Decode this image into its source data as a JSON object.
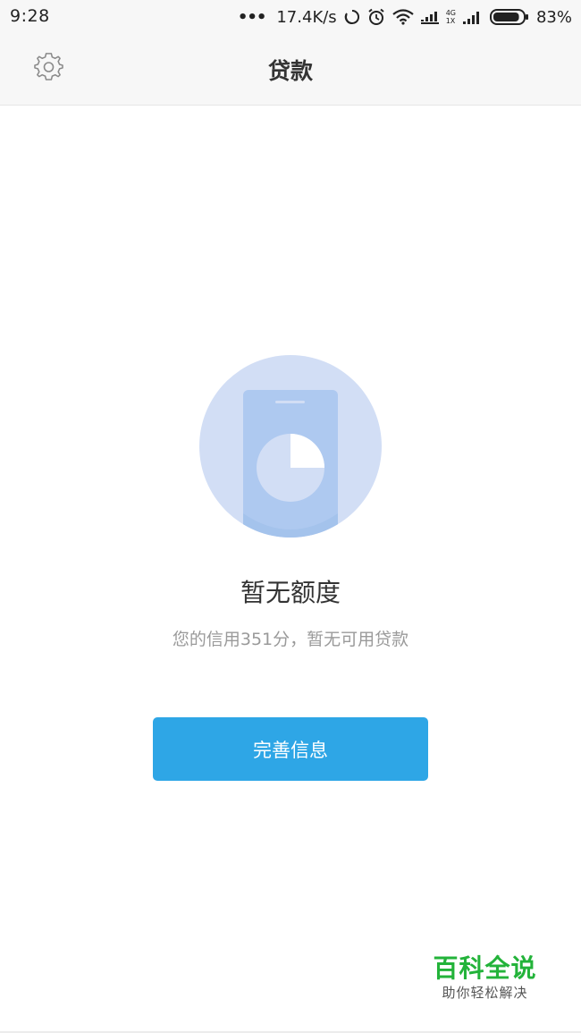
{
  "status_bar": {
    "time": "9:28",
    "more_dots": "•••",
    "net_speed": "17.4K/s",
    "network_type_top": "4G",
    "network_type_bottom": "1X",
    "battery_percent": "83%",
    "battery_level": 0.83,
    "icons": [
      "sync-icon",
      "alarm-icon",
      "wifi-icon",
      "signal-icon",
      "signal-icon",
      "battery-icon"
    ]
  },
  "nav": {
    "title": "贷款",
    "settings_icon": "gear-icon"
  },
  "empty_state": {
    "illustration_icon": "phone-pie-chart-icon",
    "title": "暂无额度",
    "subtitle": "您的信用351分，暂无可用贷款"
  },
  "actions": {
    "complete_info_label": "完善信息"
  },
  "watermark": {
    "main": "百科全说",
    "sub": "助你轻松解决"
  },
  "colors": {
    "accent": "#2ea6e6",
    "illustration_circle": "#d2def5",
    "illustration_phone": "#aec9f0",
    "watermark_green": "#23b33a"
  }
}
